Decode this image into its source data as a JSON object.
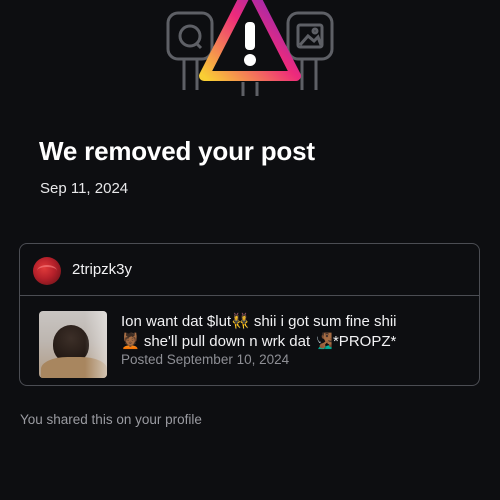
{
  "hero": {
    "icon": "removed-post-warning-illustration",
    "gradient_colors": [
      "#f9ce34",
      "#ee2a7b",
      "#6228d7"
    ],
    "outline_color": "#5e6066"
  },
  "notice": {
    "title": "We removed your post",
    "date": "Sep 11, 2024"
  },
  "post": {
    "username": "2tripzk3y",
    "caption_line1": "Ion want dat $lut👯‍♀️ shii i got sum fine shii",
    "caption_line2": "💆🏾 she'll pull down n wrk dat 🧏🏾‍♂️*PROPZ*",
    "posted": "Posted September 10, 2024"
  },
  "footer": {
    "shared_text": "You shared this on your profile"
  },
  "colors": {
    "background": "#0d0e11",
    "text_primary": "#ffffff",
    "text_secondary": "#8e8f95",
    "border": "#4b4d53"
  }
}
